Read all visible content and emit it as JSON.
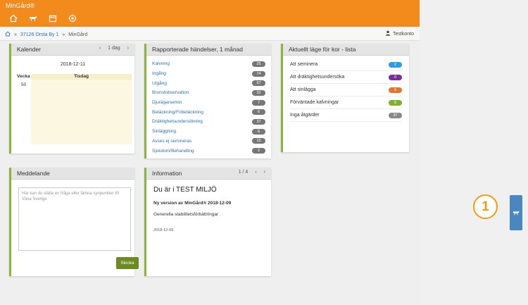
{
  "app": {
    "brand": "MinGård®"
  },
  "nav": [
    "home-icon",
    "cow-icon",
    "calendar-icon",
    "target-icon"
  ],
  "breadcrumb": {
    "farm": "37126 Orsta By 1",
    "sep": "»",
    "page": "MinGård"
  },
  "account": {
    "label": "Testkonto"
  },
  "calendar": {
    "title": "Kalender",
    "prev": "‹",
    "range": "1 dag",
    "next": "›",
    "date": "2018-12-11",
    "week_header": "Vecka",
    "day_header": "Tisdag",
    "week": "50"
  },
  "events": {
    "title": "Rapporterade händelser, 1 månad",
    "items": [
      {
        "label": "Kalvning",
        "count": "25"
      },
      {
        "label": "Ingång",
        "count": "74"
      },
      {
        "label": "Utgång",
        "count": "67"
      },
      {
        "label": "Brunstobservation",
        "count": "32"
      },
      {
        "label": "Djurägarsemin",
        "count": "7"
      },
      {
        "label": "Betäckning/Fribetäckning",
        "count": "6"
      },
      {
        "label": "Dräktighetsundersökning",
        "count": "37"
      },
      {
        "label": "Sinläggning",
        "count": "8"
      },
      {
        "label": "Avses ej semineras",
        "count": "15"
      },
      {
        "label": "Sjukdom/Behandling",
        "count": "2"
      }
    ]
  },
  "status": {
    "title": "Aktuellt läge för kor - lista",
    "items": [
      {
        "label": "Att seminera",
        "count": "2",
        "color": "#2e9ee0"
      },
      {
        "label": "Att dräktighetsundersöka",
        "count": "0",
        "color": "#7a2e9e"
      },
      {
        "label": "Att sinlägga",
        "count": "0",
        "color": "#e8742a"
      },
      {
        "label": "Förväntade kalvningar",
        "count": "0",
        "color": "#7bb32e"
      },
      {
        "label": "Inga åtgärder",
        "count": "37",
        "color": "#888888"
      }
    ]
  },
  "message": {
    "title": "Meddelande",
    "placeholder": "Här kan du ställa en fråga eller lämna synpunkter till Växa Sverige",
    "send": "Skicka"
  },
  "info": {
    "title": "Information",
    "pager": "1 / 4",
    "prev": "‹",
    "next": "›",
    "heading": "Du är i TEST MILJÖ",
    "sub": "Ny version av MinGård® 2018-12-09",
    "text": "Generella stabilitetsförbättringar",
    "date": "2018-12-09"
  },
  "callout": {
    "number": "1"
  }
}
